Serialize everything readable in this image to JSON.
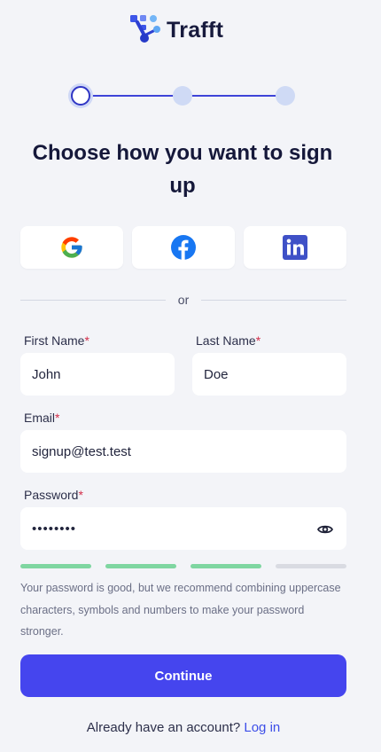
{
  "brand": {
    "name": "Trafft"
  },
  "stepper": {
    "current_step": 1,
    "total_steps": 3
  },
  "title": "Choose how you want to sign up",
  "social": [
    {
      "provider": "Google",
      "icon": "google-icon"
    },
    {
      "provider": "Facebook",
      "icon": "facebook-icon"
    },
    {
      "provider": "LinkedIn",
      "icon": "linkedin-icon"
    }
  ],
  "divider_text": "or",
  "form": {
    "first_name": {
      "label": "First Name",
      "required_mark": "*",
      "value": "John"
    },
    "last_name": {
      "label": "Last Name",
      "required_mark": "*",
      "value": "Doe"
    },
    "email": {
      "label": "Email",
      "required_mark": "*",
      "value": "signup@test.test"
    },
    "password": {
      "label": "Password",
      "required_mark": "*",
      "value": "password"
    }
  },
  "password_strength": {
    "level": 3,
    "max": 4,
    "colors": {
      "filled": "#7fd6a1",
      "empty": "#d9dbe2"
    },
    "message": "Your password is good, but we recommend combining uppercase characters, symbols and numbers to make your password stronger."
  },
  "continue_label": "Continue",
  "footer": {
    "prompt": "Already have an account?",
    "link": "Log in"
  },
  "colors": {
    "primary": "#4545ee",
    "link": "#3d4ee8",
    "required": "#d32f4a",
    "background": "#f3f4f8"
  }
}
